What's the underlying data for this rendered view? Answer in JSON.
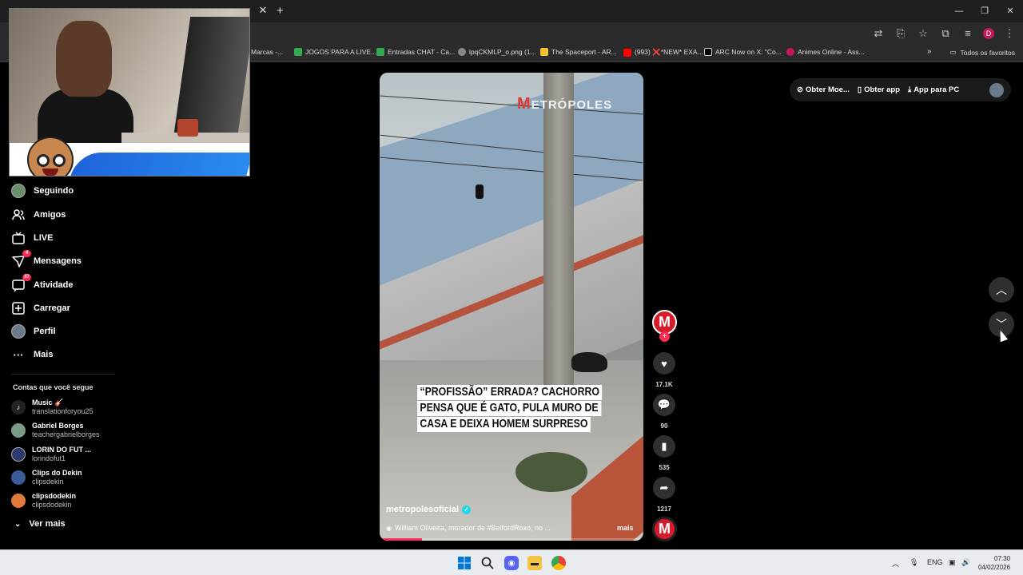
{
  "browser": {
    "window_controls": [
      "—",
      "❐",
      "✕"
    ],
    "bookmarks": [
      {
        "label": "Marcas -...",
        "color": "#555555"
      },
      {
        "label": "JOGOS PARA A LIVE...",
        "color": "#34a853"
      },
      {
        "label": "Entradas CHAT - Ca...",
        "color": "#34a853"
      },
      {
        "label": "lpqCKMLP_o.png (1...",
        "color": "#888888"
      },
      {
        "label": "The Spaceport - AR...",
        "color": "#f2c230"
      },
      {
        "label": "(993) ❌*NEW* EXA...",
        "color": "#ff0000"
      },
      {
        "label": "ARC Now on X: \"Co...",
        "color": "#000000"
      },
      {
        "label": "Animes Online - Ass...",
        "color": "#c2185b"
      }
    ],
    "all_bookmarks": "Todos os favoritos",
    "profile_initial": "D"
  },
  "nav": {
    "items": [
      {
        "label": "Seguindo",
        "badge": ""
      },
      {
        "label": "Amigos",
        "badge": ""
      },
      {
        "label": "LIVE",
        "badge": ""
      },
      {
        "label": "Mensagens",
        "badge": "4"
      },
      {
        "label": "Atividade",
        "badge": "37"
      },
      {
        "label": "Carregar",
        "badge": ""
      },
      {
        "label": "Perfil",
        "badge": ""
      },
      {
        "label": "Mais",
        "badge": ""
      }
    ],
    "following_title": "Contas que você segue",
    "accounts": [
      {
        "name": "Music 🎸",
        "handle": "translationforyou25"
      },
      {
        "name": "Gabriel Borges",
        "handle": "teachergabrielborges"
      },
      {
        "name": "LORIN DO FUT ...",
        "handle": "lorindofut1"
      },
      {
        "name": "Clips do Dekin",
        "handle": "clipsdekin"
      },
      {
        "name": "clipsdodekin",
        "handle": "clipsdodekin"
      }
    ],
    "see_more": "Ver mais"
  },
  "video": {
    "logo": "ETRÓPOLES",
    "logo_m": "M",
    "caption_lines": [
      "“PROFISSÃO” ERRADA? CACHORRO",
      "PENSA QUE É GATO, PULA MURO DE",
      "CASA E DEIXA HOMEM SURPRESO"
    ],
    "author": "metropolesoficial",
    "description": "William Oliveira, morador de #BelfordRoxo, no ...",
    "more": "mais",
    "progress": 0.16
  },
  "actions": {
    "likes": "17.1K",
    "comments": "90",
    "saves": "535",
    "shares": "1217"
  },
  "top_right": {
    "coins": "Obter Moe...",
    "app": "Obter app",
    "pc": "App para PC"
  },
  "taskbar": {
    "lang": "ENG",
    "time": "07:30",
    "date": "04/02/2026"
  }
}
